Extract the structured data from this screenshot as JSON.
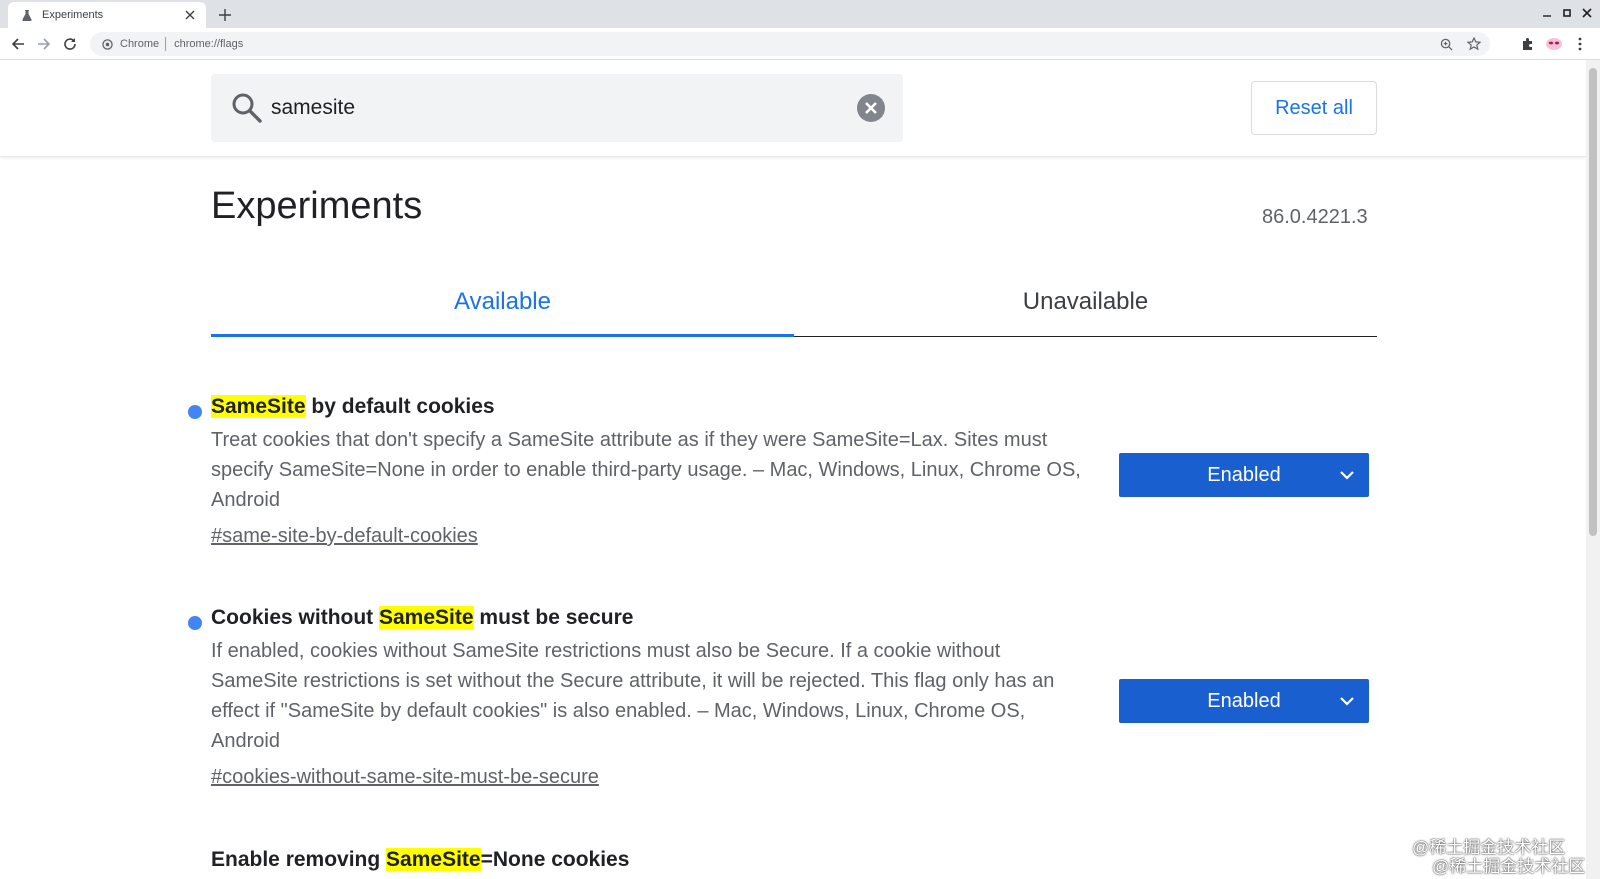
{
  "browser": {
    "tab_title": "Experiments",
    "omnibox_chip": "Chrome",
    "omnibox_url": "chrome://flags"
  },
  "search": {
    "value": "samesite"
  },
  "reset_label": "Reset all",
  "page_title": "Experiments",
  "version": "86.0.4221.3",
  "tabs": [
    {
      "label": "Available"
    },
    {
      "label": "Unavailable"
    }
  ],
  "experiments": [
    {
      "title_pre": "",
      "title_hl": "SameSite",
      "title_post": " by default cookies",
      "description": "Treat cookies that don't specify a SameSite attribute as if they were SameSite=Lax. Sites must specify SameSite=None in order to enable third-party usage. – Mac, Windows, Linux, Chrome OS, Android",
      "link": "#same-site-by-default-cookies",
      "state": "Enabled"
    },
    {
      "title_pre": "Cookies without ",
      "title_hl": "SameSite",
      "title_post": " must be secure",
      "description": "If enabled, cookies without SameSite restrictions must also be Secure. If a cookie without SameSite restrictions is set without the Secure attribute, it will be rejected. This flag only has an effect if \"SameSite by default cookies\" is also enabled. – Mac, Windows, Linux, Chrome OS, Android",
      "link": "#cookies-without-same-site-must-be-secure",
      "state": "Enabled"
    },
    {
      "title_pre": "Enable removing ",
      "title_hl": "SameSite",
      "title_post": "=None cookies"
    }
  ],
  "watermark": "@稀土掘金技术社区",
  "colors": {
    "accent": "#1a73e8",
    "select_bg": "#1a5fd0",
    "highlight": "#ffff00",
    "dot": "#4285f4"
  }
}
